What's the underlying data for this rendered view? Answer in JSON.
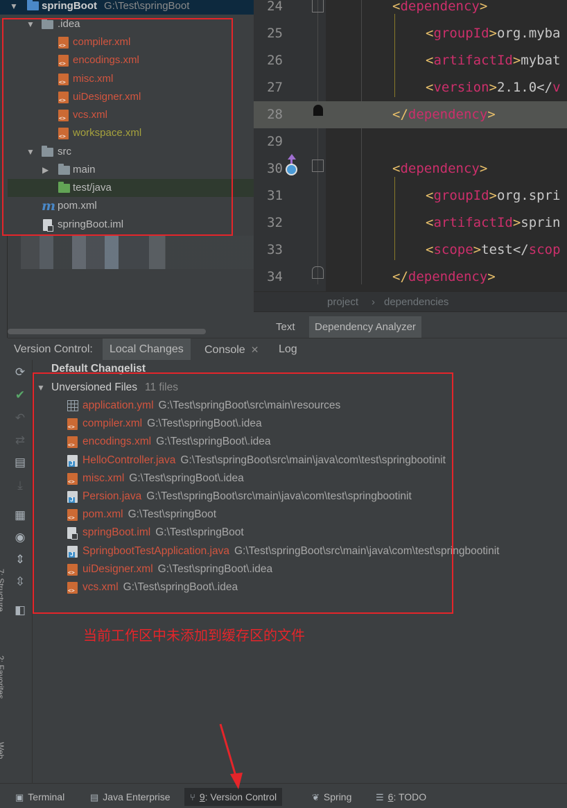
{
  "project_tree": {
    "root": {
      "name": "springBoot",
      "path": "G:\\Test\\springBoot"
    },
    "items": [
      {
        "label": "compiler.xml"
      },
      {
        "label": "encodings.xml"
      },
      {
        "label": "misc.xml"
      },
      {
        "label": "uiDesigner.xml"
      },
      {
        "label": "vcs.xml"
      },
      {
        "label": "workspace.xml"
      }
    ],
    "idea_folder": ".idea",
    "src_folder": "src",
    "main_folder": "main",
    "test_folder": "test/java",
    "pom": "pom.xml",
    "iml": "springBoot.iml"
  },
  "editor": {
    "lines": [
      {
        "num": "24",
        "open": "<",
        "name": "dependency",
        "close": ">",
        "text": "",
        "end": ""
      },
      {
        "num": "25",
        "open": "<",
        "name": "groupId",
        "close": ">",
        "text": "org.myba",
        "end": ""
      },
      {
        "num": "26",
        "open": "<",
        "name": "artifactId",
        "close": ">",
        "text": "mybat",
        "end": ""
      },
      {
        "num": "27",
        "open": "<",
        "name": "version",
        "close": ">",
        "text": "2.1.0</",
        "end": "v"
      },
      {
        "num": "28",
        "open": "</",
        "name": "dependency",
        "close": ">",
        "text": "",
        "end": ""
      },
      {
        "num": "29",
        "open": "",
        "name": "",
        "close": "",
        "text": "",
        "end": ""
      },
      {
        "num": "30",
        "open": "<",
        "name": "dependency",
        "close": ">",
        "text": "",
        "end": ""
      },
      {
        "num": "31",
        "open": "<",
        "name": "groupId",
        "close": ">",
        "text": "org.spri",
        "end": ""
      },
      {
        "num": "32",
        "open": "<",
        "name": "artifactId",
        "close": ">",
        "text": "sprin",
        "end": ""
      },
      {
        "num": "33",
        "open": "<",
        "name": "scope",
        "close": ">",
        "text": "test</",
        "end": "scop"
      },
      {
        "num": "34",
        "open": "</",
        "name": "dependency",
        "close": ">",
        "text": "",
        "end": ""
      }
    ],
    "breadcrumb": [
      "project",
      "dependencies"
    ],
    "breadcrumb_sep": "›",
    "tabs": [
      "Text",
      "Dependency Analyzer"
    ]
  },
  "version_control": {
    "title": "Version Control:",
    "tabs": [
      "Local Changes",
      "Console",
      "Log"
    ],
    "changelist": "Default Changelist",
    "group": {
      "label": "Unversioned Files",
      "count": "11 files"
    },
    "files": [
      {
        "name": "application.yml",
        "path": "G:\\Test\\springBoot\\src\\main\\resources",
        "icon": "yml-icon"
      },
      {
        "name": "compiler.xml",
        "path": "G:\\Test\\springBoot\\.idea",
        "icon": "xml-icon"
      },
      {
        "name": "encodings.xml",
        "path": "G:\\Test\\springBoot\\.idea",
        "icon": "xml-icon"
      },
      {
        "name": "HelloController.java",
        "path": "G:\\Test\\springBoot\\src\\main\\java\\com\\test\\springbootinit",
        "icon": "java-icon"
      },
      {
        "name": "misc.xml",
        "path": "G:\\Test\\springBoot\\.idea",
        "icon": "xml-icon"
      },
      {
        "name": "Persion.java",
        "path": "G:\\Test\\springBoot\\src\\main\\java\\com\\test\\springbootinit",
        "icon": "java-icon"
      },
      {
        "name": "pom.xml",
        "path": "G:\\Test\\springBoot",
        "icon": "xml-icon"
      },
      {
        "name": "springBoot.iml",
        "path": "G:\\Test\\springBoot",
        "icon": "iml-icon"
      },
      {
        "name": "SpringbootTestApplication.java",
        "path": "G:\\Test\\springBoot\\src\\main\\java\\com\\test\\springbootinit",
        "icon": "java-icon"
      },
      {
        "name": "uiDesigner.xml",
        "path": "G:\\Test\\springBoot\\.idea",
        "icon": "xml-icon"
      },
      {
        "name": "vcs.xml",
        "path": "G:\\Test\\springBoot\\.idea",
        "icon": "xml-icon"
      }
    ],
    "annotation": "当前工作区中未添加到缓存区的文件"
  },
  "side_labels": [
    "7: Structure",
    "2: Favorites",
    "Web"
  ],
  "bottom_bar": [
    {
      "num": "",
      "label": "Terminal",
      "icon": "terminal-icon"
    },
    {
      "num": "",
      "label": "Java Enterprise",
      "icon": "java-enterprise-icon"
    },
    {
      "num": "9",
      "label": ": Version Control",
      "icon": "version-control-icon"
    },
    {
      "num": "",
      "label": "Spring",
      "icon": "spring-icon"
    },
    {
      "num": "6",
      "label": ": TODO",
      "icon": "todo-icon"
    }
  ],
  "colors": {
    "annotation": "#e5252a",
    "unversioned": "#d3553f",
    "background": "#3c3f41"
  }
}
